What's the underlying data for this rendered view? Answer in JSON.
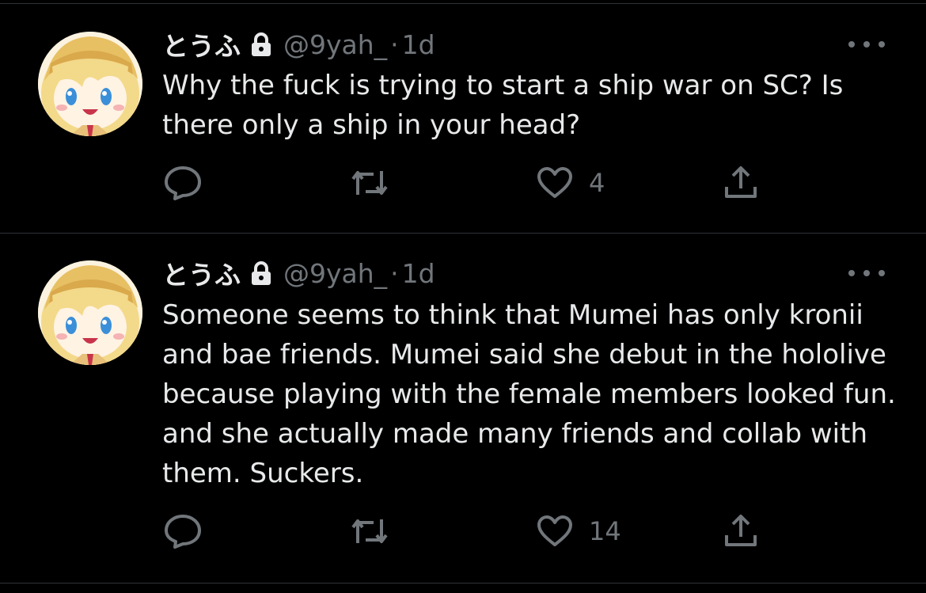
{
  "tweets": [
    {
      "display_name": "とうふ",
      "handle": "@9yah_",
      "separator": "·",
      "time": "1d",
      "text": "Why the fuck is trying to start a ship war on SC? Is there only a ship in your head?",
      "like_count": "4",
      "icons": [
        "lock-icon",
        "more-icon",
        "reply-icon",
        "retweet-icon",
        "like-icon",
        "share-icon"
      ]
    },
    {
      "display_name": "とうふ",
      "handle": "@9yah_",
      "separator": "·",
      "time": "1d",
      "text": "Someone seems to think that Mumei has only kronii and bae friends. Mumei said she debut in the hololive because playing with the female members looked fun. and she actually made many friends and collab with them. Suckers.",
      "like_count": "14",
      "icons": [
        "lock-icon",
        "more-icon",
        "reply-icon",
        "retweet-icon",
        "like-icon",
        "share-icon"
      ]
    }
  ],
  "colors": {
    "background": "#000000",
    "primary_text": "#e7e9ea",
    "secondary_text": "#71767b",
    "divider": "#2f3336"
  }
}
